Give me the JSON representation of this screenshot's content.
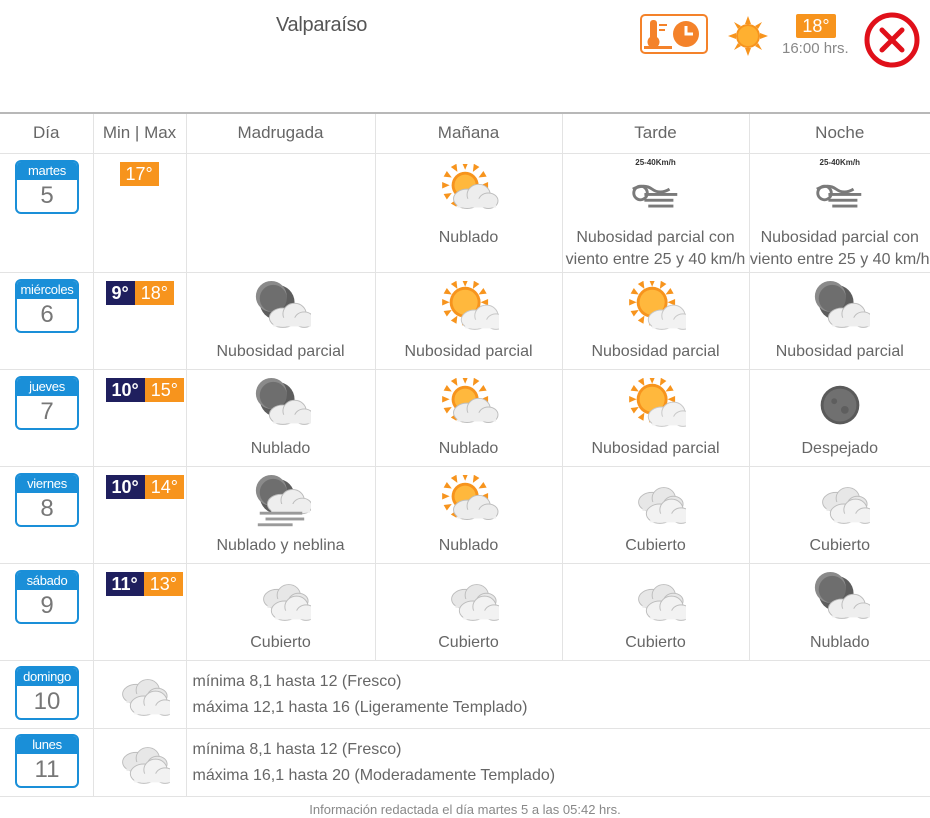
{
  "header": {
    "city": "Valparaíso",
    "current_temp": "18°",
    "current_time": "16:00 hrs.",
    "history_icon": "thermometer-clock-icon",
    "weather_icon": "sun-icon",
    "close_icon": "close-icon"
  },
  "columns": [
    "Día",
    "Min | Max",
    "Madrugada",
    "Mañana",
    "Tarde",
    "Noche"
  ],
  "days": [
    {
      "name": "martes",
      "num": "5",
      "min": "",
      "max": "17°",
      "madrugada": {
        "icon": "",
        "label": ""
      },
      "manana": {
        "icon": "sun-cloud-icon",
        "label": "Nublado"
      },
      "tarde": {
        "icon": "wind-icon",
        "label": "Nubosidad parcial con viento entre 25 y 40 km/h",
        "wind": "25-40Km/h"
      },
      "noche": {
        "icon": "wind-icon",
        "label": "Nubosidad parcial con viento entre 25 y 40 km/h",
        "wind": "25-40Km/h"
      }
    },
    {
      "name": "miércoles",
      "num": "6",
      "min": "9°",
      "max": "18°",
      "madrugada": {
        "icon": "moon-cloud-icon",
        "label": "Nubosidad parcial"
      },
      "manana": {
        "icon": "sun-partial-cloud-icon",
        "label": "Nubosidad parcial"
      },
      "tarde": {
        "icon": "sun-partial-cloud-icon",
        "label": "Nubosidad parcial"
      },
      "noche": {
        "icon": "moon-cloud-icon",
        "label": "Nubosidad parcial"
      }
    },
    {
      "name": "jueves",
      "num": "7",
      "min": "10°",
      "max": "15°",
      "madrugada": {
        "icon": "moon-cloud-icon",
        "label": "Nublado"
      },
      "manana": {
        "icon": "sun-cloud-icon",
        "label": "Nublado"
      },
      "tarde": {
        "icon": "sun-partial-cloud-icon",
        "label": "Nubosidad parcial"
      },
      "noche": {
        "icon": "moon-icon",
        "label": "Despejado"
      }
    },
    {
      "name": "viernes",
      "num": "8",
      "min": "10°",
      "max": "14°",
      "madrugada": {
        "icon": "moon-fog-icon",
        "label": "Nublado y neblina"
      },
      "manana": {
        "icon": "sun-cloud-icon",
        "label": "Nublado"
      },
      "tarde": {
        "icon": "cloud-icon",
        "label": "Cubierto"
      },
      "noche": {
        "icon": "cloud-icon",
        "label": "Cubierto"
      }
    },
    {
      "name": "sábado",
      "num": "9",
      "min": "11°",
      "max": "13°",
      "madrugada": {
        "icon": "cloud-icon",
        "label": "Cubierto"
      },
      "manana": {
        "icon": "cloud-icon",
        "label": "Cubierto"
      },
      "tarde": {
        "icon": "cloud-icon",
        "label": "Cubierto"
      },
      "noche": {
        "icon": "moon-cloud-icon",
        "label": "Nublado"
      }
    }
  ],
  "extended": [
    {
      "name": "domingo",
      "num": "10",
      "icon": "cloud-icon",
      "line1": "mínima 8,1 hasta 12 (Fresco)",
      "line2": "máxima 12,1 hasta 16 (Ligeramente Templado)"
    },
    {
      "name": "lunes",
      "num": "11",
      "icon": "cloud-icon",
      "line1": "mínima 8,1 hasta 12 (Fresco)",
      "line2": "máxima 16,1 hasta 20 (Moderadamente Templado)"
    }
  ],
  "footer": "Información redactada el día martes 5 a las 05:42 hrs.",
  "colors": {
    "accent_blue": "#1a8fd8",
    "orange": "#f7941d",
    "navy": "#1f1f5e",
    "close_red": "#e0101a"
  }
}
